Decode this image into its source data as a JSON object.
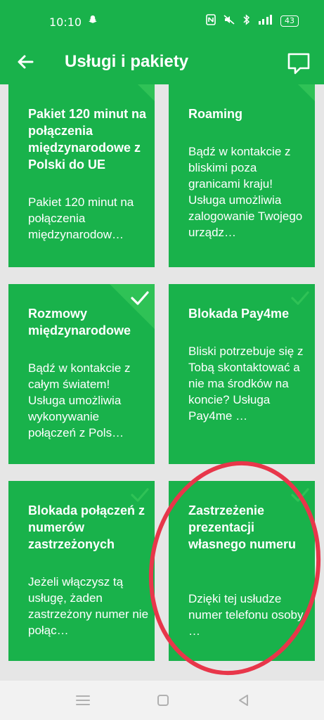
{
  "status_bar": {
    "time": "10:10",
    "battery": "43"
  },
  "app_bar": {
    "title": "Usługi i pakiety"
  },
  "cards": [
    {
      "title": "Pakiet 120 minut na połączenia międzynarodowe z Polski do UE",
      "description": "Pakiet 120 minut na połączenia międzynarodow…"
    },
    {
      "title": "Roaming",
      "description": "Bądź w kontakcie z bliskimi poza granicami kraju! Usługa umożliwia zalogowanie Twojego urządz…"
    },
    {
      "title": "Rozmowy międzynarodowe",
      "description": "Bądź w kontakcie z całym światem! Usługa umożliwia wykonywanie połączeń z Pols…"
    },
    {
      "title": "Blokada Pay4me",
      "description": "Bliski potrzebuje się z Tobą skontaktować a nie ma środków na koncie? Usługa Pay4me …"
    },
    {
      "title": "Blokada połączeń z numerów zastrzeżonych",
      "description": "Jeżeli włączysz tą usługę, żaden zastrzeżony numer nie połąc…"
    },
    {
      "title": "Zastrzeżenie prezentacji własnego numeru",
      "description": "Dzięki tej usłudze numer telefonu osoby …"
    }
  ],
  "colors": {
    "brand_green": "#19b24b",
    "annotation_red": "#e8364a"
  }
}
